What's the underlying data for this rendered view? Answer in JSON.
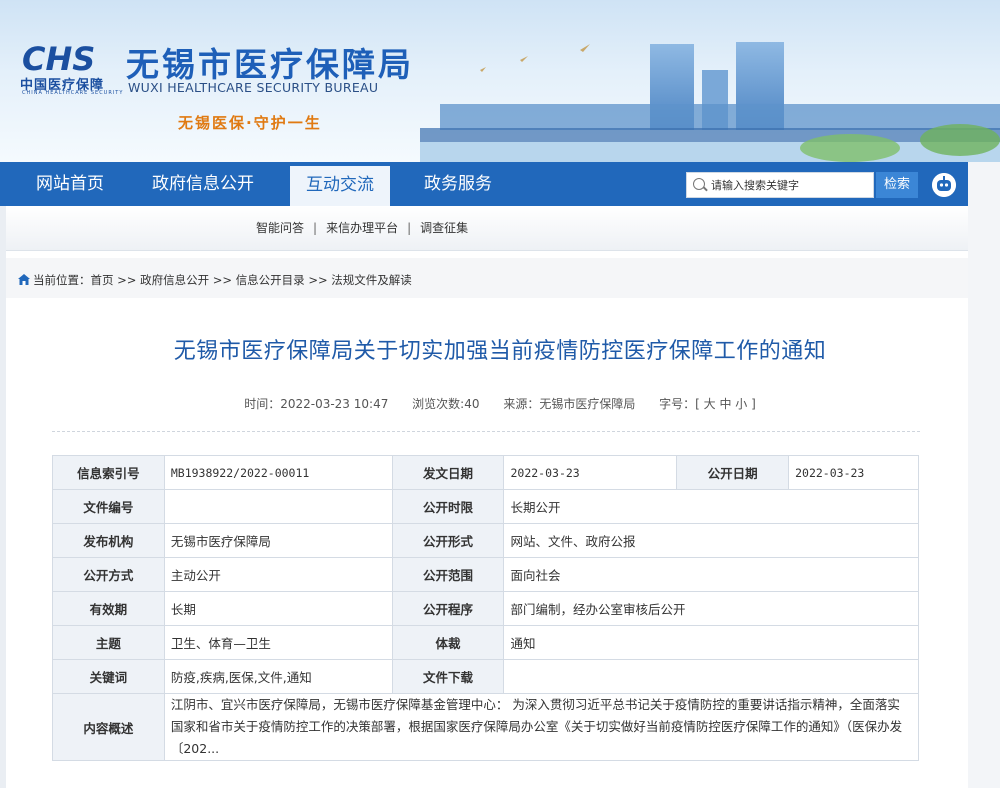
{
  "header": {
    "logo_abbr": "CHS",
    "logo_cn": "中国医疗保障",
    "logo_en_small": "CHINA HEALTHCARE SECURITY",
    "site_title": "无锡市医疗保障局",
    "site_subtitle": "WUXI HEALTHCARE SECURITY BUREAU",
    "slogan": "无锡医保·守护一生"
  },
  "nav": {
    "items": [
      "网站首页",
      "政府信息公开",
      "互动交流",
      "政务服务"
    ],
    "active_index": 2,
    "search_placeholder": "请输入搜索关键字",
    "search_button": "检索"
  },
  "subnav": {
    "links": [
      "智能问答",
      "来信办理平台",
      "调查征集"
    ],
    "separator": "|"
  },
  "breadcrumb": {
    "label": "当前位置：",
    "items": [
      "首页",
      "政府信息公开",
      "信息公开目录",
      "法规文件及解读"
    ],
    "separator": ">>"
  },
  "article": {
    "title": "无锡市医疗保障局关于切实加强当前疫情防控医疗保障工作的通知",
    "time": "时间：2022-03-23 10:47",
    "views": "浏览次数:40",
    "source": "来源：无锡市医疗保障局",
    "font_size": "字号：[ 大 中 小 ]"
  },
  "info_table": {
    "index_no_label": "信息索引号",
    "index_no": "MB1938922/2022-00011",
    "issue_date_label": "发文日期",
    "issue_date": "2022-03-23",
    "publish_date_label": "公开日期",
    "publish_date": "2022-03-23",
    "doc_no_label": "文件编号",
    "doc_no": "",
    "publish_period_label": "公开时限",
    "publish_period": "长期公开",
    "issuer_label": "发布机构",
    "issuer": "无锡市医疗保障局",
    "publish_form_label": "公开形式",
    "publish_form": "网站、文件、政府公报",
    "publish_mode_label": "公开方式",
    "publish_mode": "主动公开",
    "publish_scope_label": "公开范围",
    "publish_scope": "面向社会",
    "validity_label": "有效期",
    "validity": "长期",
    "publish_procedure_label": "公开程序",
    "publish_procedure": "部门编制，经办公室审核后公开",
    "subject_label": "主题",
    "subject": "卫生、体育—卫生",
    "genre_label": "体裁",
    "genre": "通知",
    "keywords_label": "关键词",
    "keywords": "防疫,疾病,医保,文件,通知",
    "download_label": "文件下载",
    "download": "",
    "summary_label": "内容概述",
    "summary": "江阴市、宜兴市医疗保障局，无锡市医疗保障基金管理中心： 为深入贯彻习近平总书记关于疫情防控的重要讲话指示精神，全面落实国家和省市关于疫情防控工作的决策部署，根据国家医疗保障局办公室《关于切实做好当前疫情防控医疗保障工作的通知》（医保办发〔202..."
  },
  "colors": {
    "nav_blue": "#2168bb",
    "title_blue": "#1f5aa8",
    "slogan_orange": "#e07a12"
  }
}
